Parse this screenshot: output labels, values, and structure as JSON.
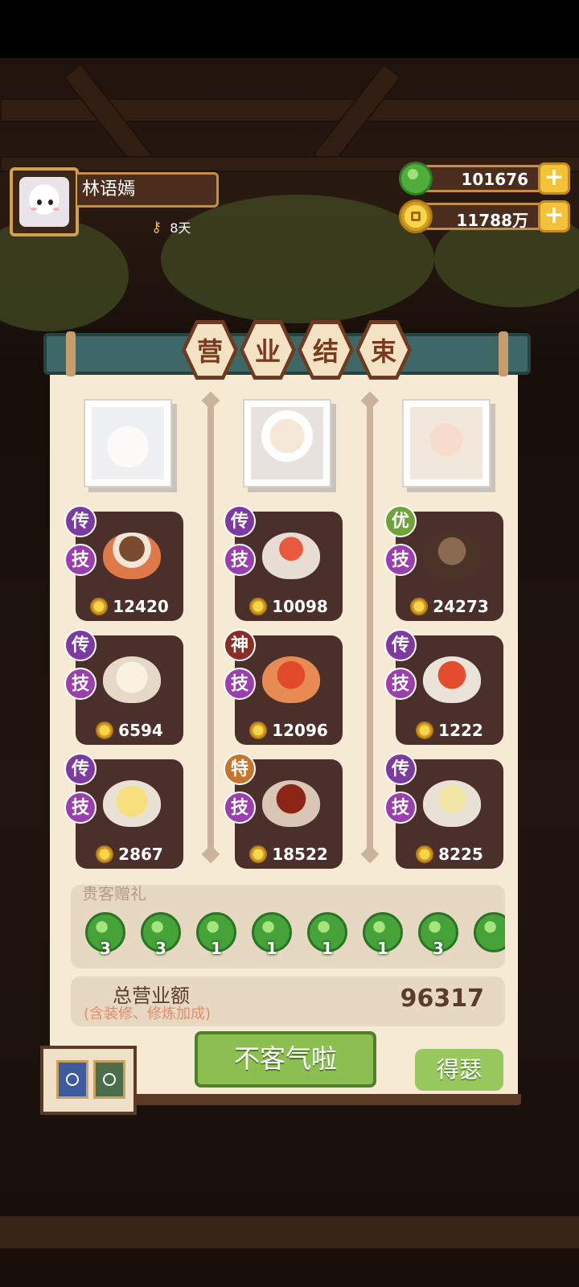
{
  "player": {
    "name": "林语嫣",
    "days": "8天"
  },
  "resources": {
    "jade": "101676",
    "coins": "11788万"
  },
  "panel": {
    "title_chars": [
      "营",
      "业",
      "结",
      "束"
    ],
    "columns": [
      {
        "dishes": [
          {
            "rank": "传",
            "skill": "技",
            "price": "12420",
            "rank_color": "#7d3aa1"
          },
          {
            "rank": "传",
            "skill": "技",
            "price": "6594",
            "rank_color": "#7d3aa1"
          },
          {
            "rank": "传",
            "skill": "技",
            "price": "2867",
            "rank_color": "#7d3aa1"
          }
        ]
      },
      {
        "dishes": [
          {
            "rank": "传",
            "skill": "技",
            "price": "10098",
            "rank_color": "#7d3aa1"
          },
          {
            "rank": "神",
            "skill": "技",
            "price": "12096",
            "rank_color": "#8a2d26"
          },
          {
            "rank": "特",
            "skill": "技",
            "price": "18522",
            "rank_color": "#c5762c"
          }
        ]
      },
      {
        "dishes": [
          {
            "rank": "优",
            "skill": "技",
            "price": "24273",
            "rank_color": "#6ea43a"
          },
          {
            "rank": "传",
            "skill": "技",
            "price": "1222",
            "rank_color": "#7d3aa1"
          },
          {
            "rank": "传",
            "skill": "技",
            "price": "8225",
            "rank_color": "#7d3aa1"
          }
        ]
      }
    ],
    "gifts": {
      "title": "贵客赠礼",
      "counts": [
        "3",
        "3",
        "1",
        "1",
        "1",
        "1",
        "3"
      ]
    },
    "total": {
      "label": "总营业额",
      "sub": "(含装修、修炼加成)",
      "value": "96317"
    },
    "buttons": {
      "main": "不客气啦",
      "side": "得瑟"
    }
  },
  "colors": {
    "panel_bg": "#f6ead4",
    "scroll_teal": "#3e6767",
    "button_green": "#8bbf52"
  }
}
